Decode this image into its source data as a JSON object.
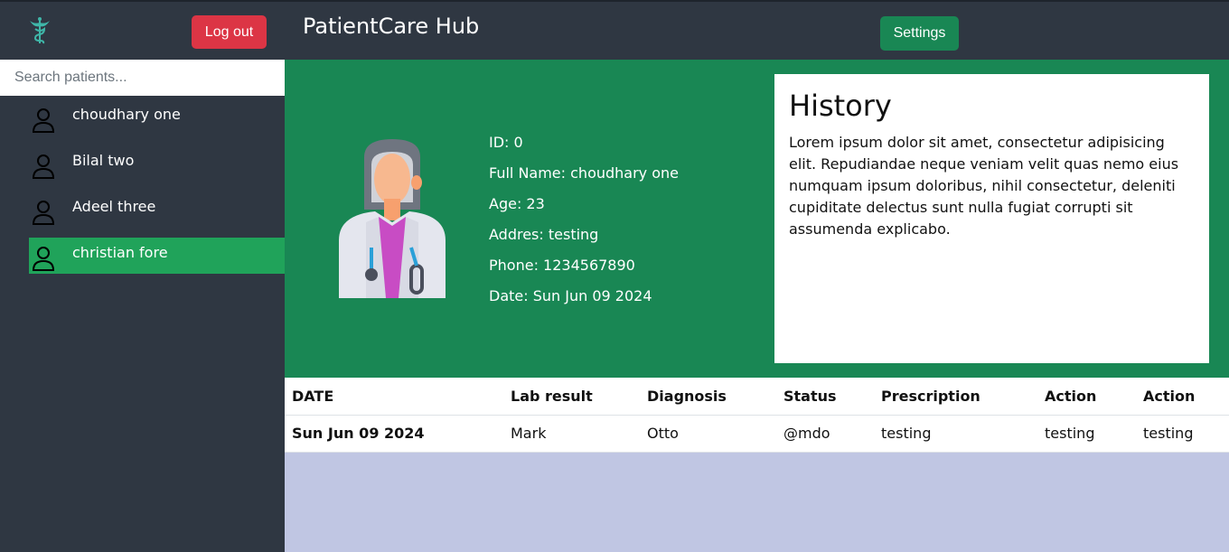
{
  "header": {
    "logout_label": "Log out",
    "title": "PatientCare Hub",
    "settings_label": "Settings"
  },
  "sidebar": {
    "search_placeholder": "Search patients...",
    "patients": [
      {
        "name": "choudhary one",
        "active": false
      },
      {
        "name": "Bilal two",
        "active": false
      },
      {
        "name": "Adeel three",
        "active": false
      },
      {
        "name": "christian fore",
        "active": true
      }
    ]
  },
  "profile": {
    "id": "ID: 0",
    "full_name": "Full Name: choudhary one",
    "age": "Age: 23",
    "address": "Addres: testing",
    "phone": "Phone: 1234567890",
    "date": "Date: Sun Jun 09 2024"
  },
  "history": {
    "title": "History",
    "text": "Lorem ipsum dolor sit amet, consectetur adipisicing elit. Repudiandae neque veniam velit quas nemo eius numquam ipsum doloribus, nihil consectetur, deleniti cupiditate delectus sunt nulla fugiat corrupti sit assumenda explicabo."
  },
  "table": {
    "headers": [
      "DATE",
      "Lab result",
      "Diagnosis",
      "Status",
      "Prescription",
      "Action",
      "Action"
    ],
    "rows": [
      [
        "Sun Jun 09 2024",
        "Mark",
        "Otto",
        "@mdo",
        "testing",
        "testing",
        "testing"
      ]
    ]
  },
  "colors": {
    "nav_bg": "#2f3742",
    "brand_green": "#198754",
    "active_item": "#20a35a",
    "logout_red": "#dc3545",
    "content_bg": "#c0c6e3"
  },
  "icons": {
    "logo": "caduceus-icon",
    "patient": "user-outline-icon",
    "avatar": "female-doctor-avatar"
  }
}
